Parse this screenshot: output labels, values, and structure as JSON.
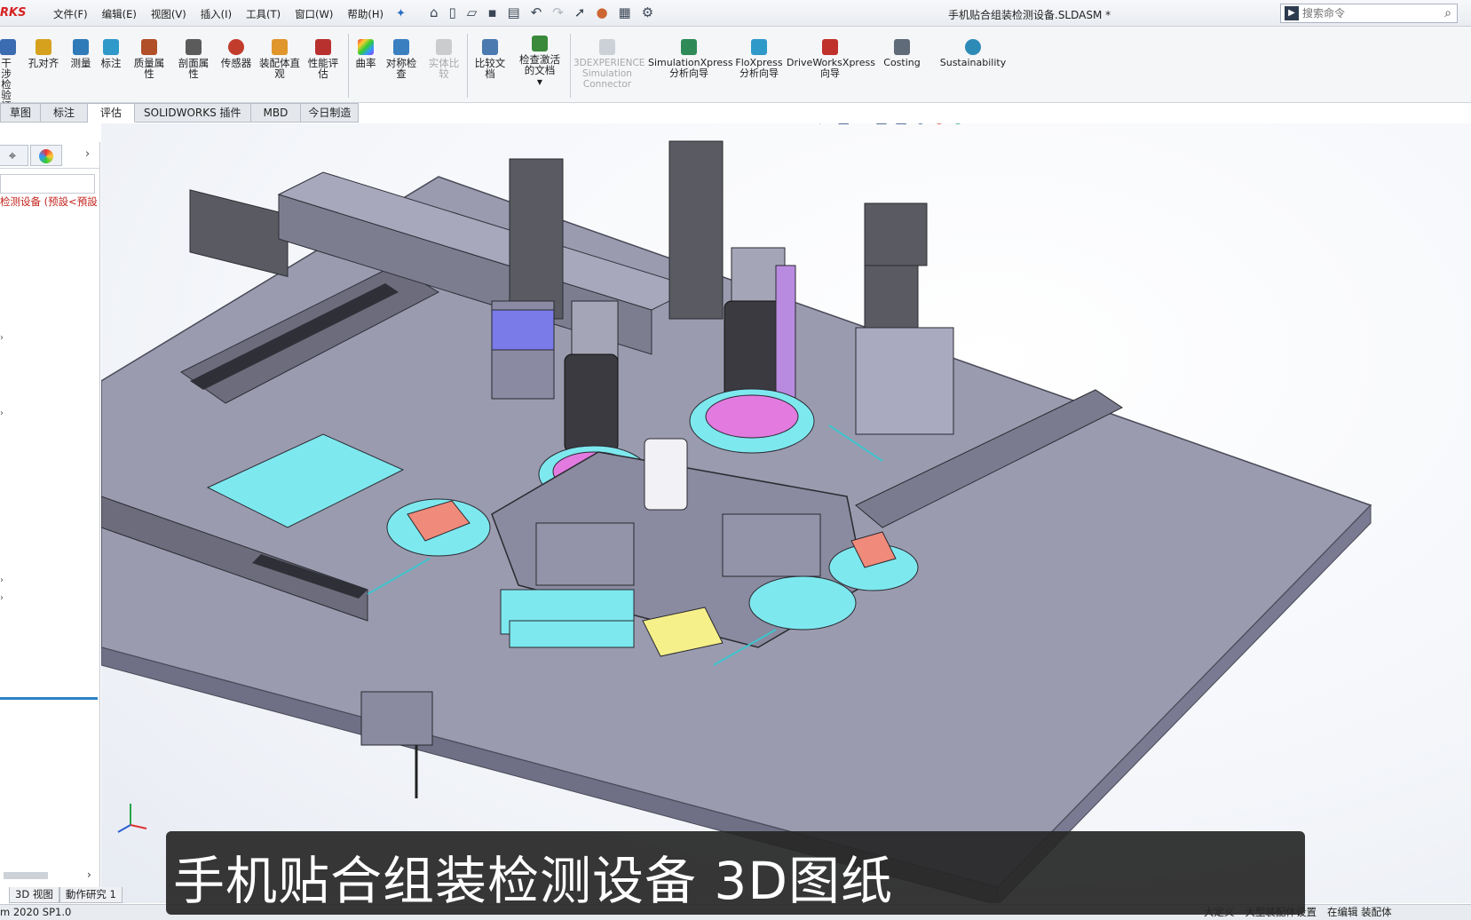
{
  "app": {
    "logo_text": "RKS",
    "document_title": "手机贴合组装检测设备.SLDASM *"
  },
  "menu": [
    "文件(F)",
    "编辑(E)",
    "视图(V)",
    "插入(I)",
    "工具(T)",
    "窗口(W)",
    "帮助(H)"
  ],
  "search": {
    "placeholder": "搜索命令"
  },
  "ribbon": {
    "items": [
      {
        "label": "干涉检验证",
        "icon": "interference-icon",
        "color": "#3b6bb0"
      },
      {
        "label": "孔对齐",
        "icon": "hole-align-icon",
        "color": "#d6a11d"
      },
      {
        "label": "测量",
        "icon": "measure-icon",
        "color": "#2f7ab8"
      },
      {
        "label": "标注",
        "icon": "markup-icon",
        "color": "#2f9ac9"
      },
      {
        "label": "质量属性",
        "icon": "mass-properties-icon",
        "color": "#b04f28"
      },
      {
        "label": "剖面属性",
        "icon": "section-properties-icon",
        "color": "#5b5b5b"
      },
      {
        "label": "传感器",
        "icon": "sensor-icon",
        "color": "#c23c2c"
      },
      {
        "label": "装配体直观",
        "icon": "assembly-visualization-icon",
        "color": "#e0962b"
      },
      {
        "label": "性能评估",
        "icon": "performance-evaluation-icon",
        "color": "#b8312f"
      },
      {
        "label": "曲率",
        "icon": "curvature-icon",
        "color": "#9a3dc8"
      },
      {
        "label": "对称检查",
        "icon": "symmetry-check-icon",
        "color": "#3a7fc0"
      },
      {
        "label": "实体比较",
        "icon": "body-compare-icon",
        "color": "#999999",
        "disabled": true
      },
      {
        "label": "比较文档",
        "icon": "compare-documents-icon",
        "color": "#4a7ab0"
      },
      {
        "label": "检查激活的文档",
        "icon": "check-active-document-icon",
        "color": "#3b8a3b"
      },
      {
        "label": "3DEXPERIENCE Simulation Connector",
        "icon": "3dexperience-icon",
        "color": "#9aa3ad",
        "disabled": true
      },
      {
        "label": "SimulationXpress 分析向导",
        "icon": "simulationxpress-icon",
        "color": "#2e8b57"
      },
      {
        "label": "FloXpress 分析向导",
        "icon": "floxpress-icon",
        "color": "#2f9ac9"
      },
      {
        "label": "DriveWorksXpress 向导",
        "icon": "driveworksxpress-icon",
        "color": "#c0312b"
      },
      {
        "label": "Costing",
        "icon": "costing-icon",
        "color": "#5f6b78"
      },
      {
        "label": "Sustainability",
        "icon": "sustainability-icon",
        "color": "#2e8bb8"
      }
    ]
  },
  "tabs": [
    {
      "label": "草图"
    },
    {
      "label": "标注"
    },
    {
      "label": "评估",
      "active": true
    },
    {
      "label": "SOLIDWORKS 插件"
    },
    {
      "label": "MBD"
    },
    {
      "label": "今日制造"
    }
  ],
  "tree": {
    "root_label": "检测设备 (预設<預設"
  },
  "bottom_tabs": [
    "3D 视图",
    "動作研究 1"
  ],
  "status": {
    "left": "m 2020 SP1.0",
    "right": [
      "大定义",
      "大型装配体设置",
      "在编辑 装配体"
    ]
  },
  "caption": "手机贴合组装检测设备 3D图纸",
  "colors": {
    "plate": "#9b9bb0",
    "plate_dark": "#6f6f86",
    "cyan": "#7ee8ef",
    "magenta": "#e27ae0",
    "salmon": "#f08a7a",
    "motor": "#5a5a62",
    "yellow": "#f5f08a"
  }
}
